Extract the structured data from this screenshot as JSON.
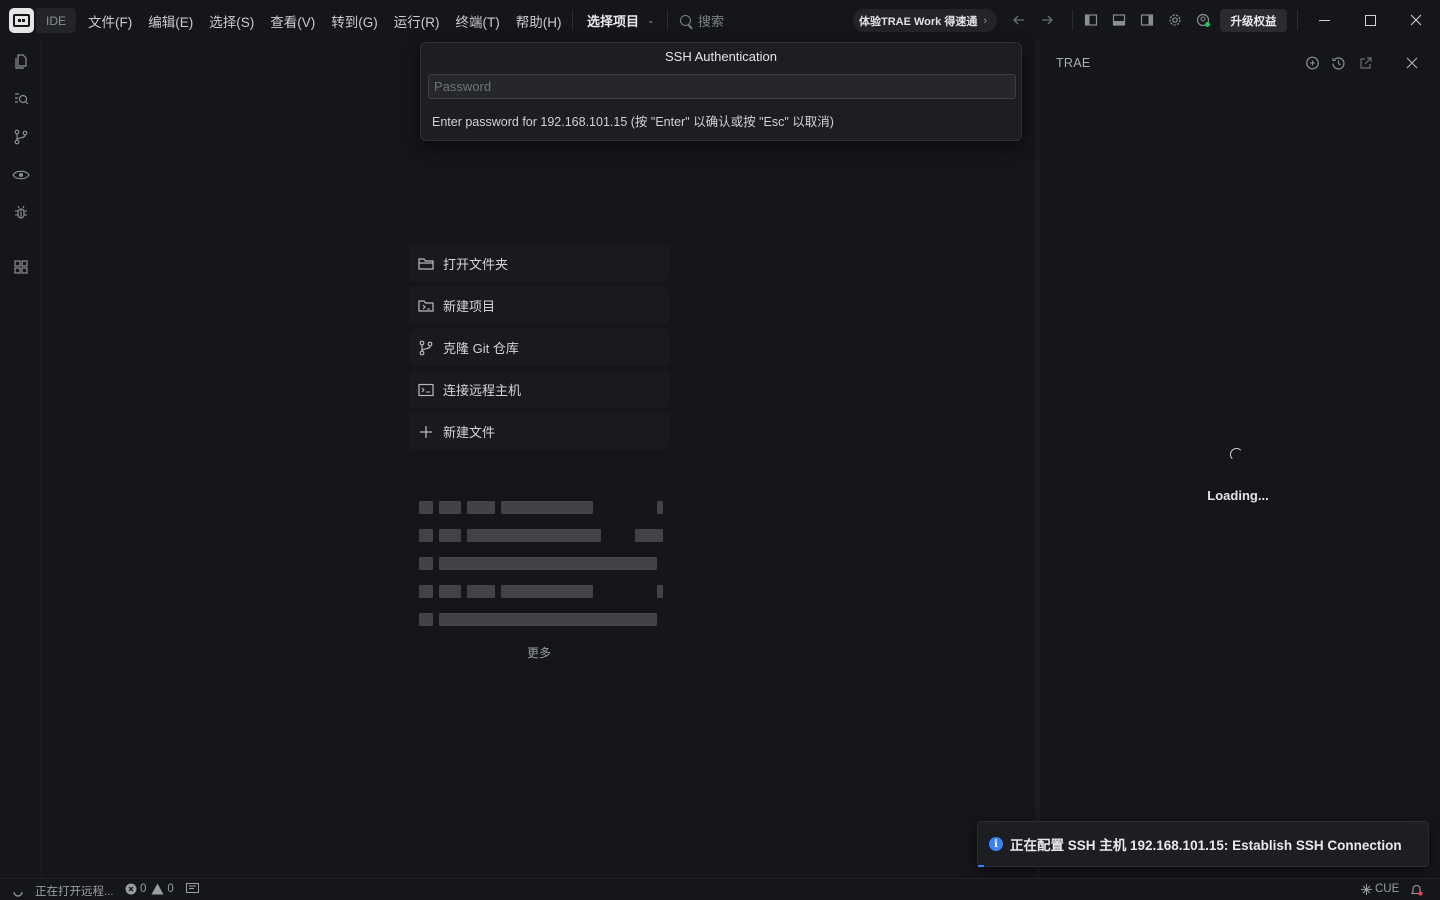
{
  "app": {
    "mode_tag": "IDE"
  },
  "menu": [
    "文件(F)",
    "编辑(E)",
    "选择(S)",
    "查看(V)",
    "转到(G)",
    "运行(R)",
    "终端(T)",
    "帮助(H)"
  ],
  "project_select": {
    "label": "选择项目"
  },
  "search": {
    "label": "搜索"
  },
  "promo": {
    "label": "体验TRAE Work 得速通"
  },
  "upgrade": {
    "label": "升级权益"
  },
  "quick_input": {
    "title": "SSH Authentication",
    "placeholder": "Password",
    "value": "",
    "hint": "Enter password for 192.168.101.15 (按 \"Enter\" 以确认或按 \"Esc\" 以取消)"
  },
  "welcome": {
    "actions": [
      {
        "label": "打开文件夹",
        "icon": "folder-icon"
      },
      {
        "label": "新建项目",
        "icon": "new-project-icon"
      },
      {
        "label": "克隆 Git 仓库",
        "icon": "git-branch-icon"
      },
      {
        "label": "连接远程主机",
        "icon": "terminal-icon"
      },
      {
        "label": "新建文件",
        "icon": "plus-icon"
      }
    ],
    "more": "更多"
  },
  "panel": {
    "title": "TRAE",
    "loading": "Loading..."
  },
  "notification": {
    "message": "正在配置 SSH 主机 192.168.101.15: Establish SSH Connection",
    "accent": "#3b82f6"
  },
  "status": {
    "remote": "正在打开远程...",
    "errors": "0",
    "warnings": "0",
    "right": "CUE"
  },
  "colors": {
    "background": "#151619",
    "accent": "#3b82f6"
  }
}
